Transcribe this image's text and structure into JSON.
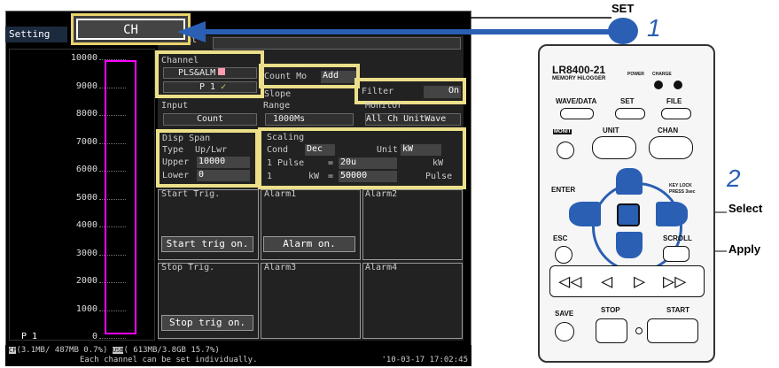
{
  "header": {
    "setting_tab": "Setting",
    "ch_tab": "CH"
  },
  "graph": {
    "y_ticks": [
      "10000",
      "9000",
      "8000",
      "7000",
      "6000",
      "5000",
      "4000",
      "3000",
      "2000",
      "1000",
      "0"
    ],
    "channel_label": "P 1"
  },
  "channel": {
    "title": "Channel",
    "mode": "PLS&ALM",
    "number": "P 1",
    "check": "✓"
  },
  "count": {
    "label": "Count Mo",
    "value": "Add",
    "slope": "Slope"
  },
  "filter": {
    "label": "Filter",
    "value": "On"
  },
  "input": {
    "title": "Input",
    "value": "Count"
  },
  "range": {
    "title": "Range",
    "value": "1000Ms"
  },
  "monitor": {
    "title": "Monitor",
    "value": "All Ch UnitWave"
  },
  "comment": {
    "title": "Comment"
  },
  "disp_span": {
    "title": "Disp Span",
    "type_label": "Type",
    "type_value": "Up/Lwr",
    "upper_label": "Upper",
    "upper_value": "10000",
    "lower_label": "Lower",
    "lower_value": "0"
  },
  "scaling": {
    "title": "Scaling",
    "cond_label": "Cond",
    "cond_value": "Dec",
    "unit_label": "Unit",
    "unit_value": "kW",
    "pulse_label": "1 Pulse",
    "eq1": "=",
    "pulse_value": "20u",
    "pulse_unit": "kW",
    "row2_left": "1",
    "row2_unit": "kW",
    "eq2": "=",
    "row2_value": "50000",
    "row2_right": "Pulse"
  },
  "start_trig": {
    "title": "Start Trig.",
    "button": "Start trig on."
  },
  "alarm1": {
    "title": "Alarm1",
    "button": "Alarm on."
  },
  "alarm2": {
    "title": "Alarm2"
  },
  "stop_trig": {
    "title": "Stop Trig.",
    "button": "Stop trig on."
  },
  "alarm3": {
    "title": "Alarm3"
  },
  "alarm4": {
    "title": "Alarm4"
  },
  "status": {
    "cf": "CF",
    "storage1": "(3.1MB/ 487MB  0.7%)",
    "usb": "USB",
    "storage2": "( 613MB/3.8GB 15.7%)",
    "message": "Each channel can be set individually.",
    "datetime": "'10-03-17 17:02:45"
  },
  "device": {
    "model": "LR8400-21",
    "subtitle": "MEMORY HiLOGGER",
    "power": "POWER",
    "charge": "CHARGE",
    "wave_data": "WAVE/DATA",
    "set": "SET",
    "file": "FILE",
    "monit": "MONIT",
    "unit": "UNIT",
    "chan": "CHAN",
    "enter": "ENTER",
    "keylock": "KEY LOCK",
    "press": "PRESS 3sec",
    "esc": "ESC",
    "scroll": "SCROLL",
    "save": "SAVE",
    "stop": "STOP",
    "start": "START"
  },
  "annotations": {
    "set_label": "SET",
    "step1": "1",
    "step2": "2",
    "select": "Select",
    "apply": "Apply"
  },
  "colors": {
    "highlight": "#ecdf8a",
    "arrow": "#2a5fb3",
    "waveform": "#ff00ff"
  }
}
